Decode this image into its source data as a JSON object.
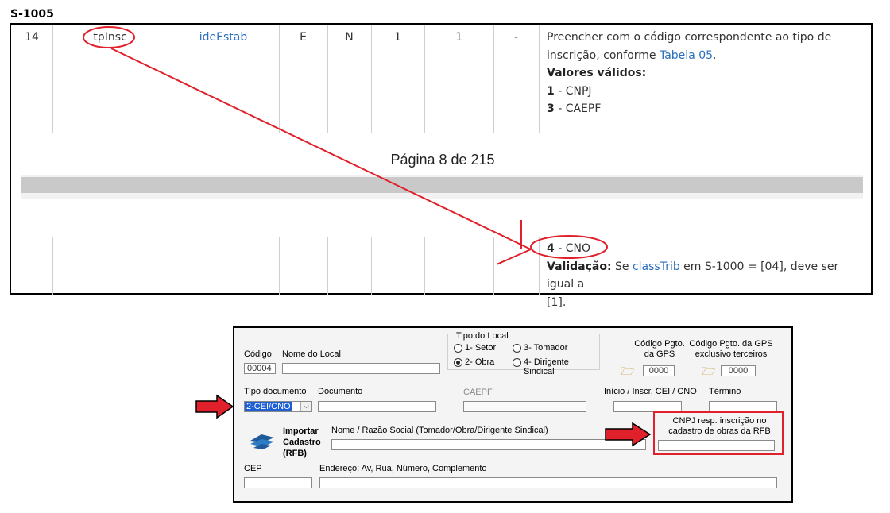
{
  "header": {
    "title": "S-1005"
  },
  "doc_table": {
    "row": {
      "seq": "14",
      "name": "tpInsc",
      "group": "ideEstab",
      "elem": "E",
      "type": "N",
      "occ_min": "1",
      "occ_max": "1",
      "size": "-",
      "desc_line1": "Preencher com o código correspondente ao tipo de",
      "desc_line2_pre": "inscrição, conforme ",
      "desc_link": "Tabela 05",
      "desc_line2_post": ".",
      "valid_values_label": "Valores válidos:",
      "v1_code": "1",
      "v1_text": " - CNPJ",
      "v3_code": "3",
      "v3_text": " - CAEPF"
    },
    "page_label": "Página 8 de 215",
    "continued": {
      "v4_code": "4",
      "v4_text": " - CNO",
      "validation_label": "Validação:",
      "validation_pre": " Se ",
      "validation_link": "classTrib",
      "validation_post": " em S-1000 = [04], deve ser igual a",
      "validation_line2": "[1]."
    }
  },
  "form": {
    "codigo_label": "Código",
    "codigo_value": "00004",
    "nome_local_label": "Nome do Local",
    "nome_local_value": "",
    "tipo_local_label": "Tipo do Local",
    "tipo_local_options": [
      {
        "label": "1- Setor",
        "selected": false
      },
      {
        "label": "3- Tomador",
        "selected": false
      },
      {
        "label": "2- Obra",
        "selected": true
      },
      {
        "label": "4- Dirigente Sindical",
        "selected": false
      }
    ],
    "codigo_gps_label1": "Código Pgto.",
    "codigo_gps_label2": "da GPS",
    "codigo_gps_value": "0000",
    "codigo_gps_terc_label1": "Código Pgto. da GPS",
    "codigo_gps_terc_label2": "exclusivo terceiros",
    "codigo_gps_terc_value": "0000",
    "tipo_doc_label": "Tipo documento",
    "tipo_doc_value": "2-CEI/CNO",
    "documento_label": "Documento",
    "caepf_label": "CAEPF",
    "inicio_label": "Início / Inscr. CEI / CNO",
    "termino_label": "Término",
    "importar_l1": "Importar",
    "importar_l2": "Cadastro",
    "importar_l3": "(RFB)",
    "nome_razao_label": "Nome / Razão Social (Tomador/Obra/Dirigente Sindical)",
    "cnpj_resp_l1": "CNPJ resp. inscrição no",
    "cnpj_resp_l2": "cadastro de obras da RFB",
    "cep_label": "CEP",
    "endereco_label": "Endereço: Av, Rua, Número, Complemento"
  },
  "colors": {
    "annotation_red": "#e0202a",
    "link_blue": "#2a6fbd",
    "selection_blue": "#1f5fd6"
  },
  "icons": [
    "folder-icon",
    "receita-federal-logo-icon",
    "arrow-right-icon",
    "radio-icon",
    "dropdown-chevron-icon"
  ]
}
